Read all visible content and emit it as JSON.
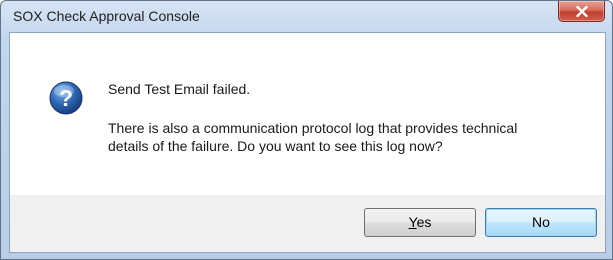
{
  "window": {
    "title": "SOX Check Approval Console"
  },
  "icons": {
    "close": "close-icon",
    "question": "question-icon"
  },
  "message": {
    "heading": "Send Test Email failed.",
    "body_line1": "There is also a communication protocol log that provides technical",
    "body_line2": "details of the failure. Do you want to see this log now?"
  },
  "buttons": {
    "yes_mnemonic": "Y",
    "yes_rest": "es",
    "no_label": "No"
  },
  "colors": {
    "close_button": "#c94a3b",
    "icon_blue": "#2e69b6",
    "default_button_border": "#3c7fb1"
  }
}
